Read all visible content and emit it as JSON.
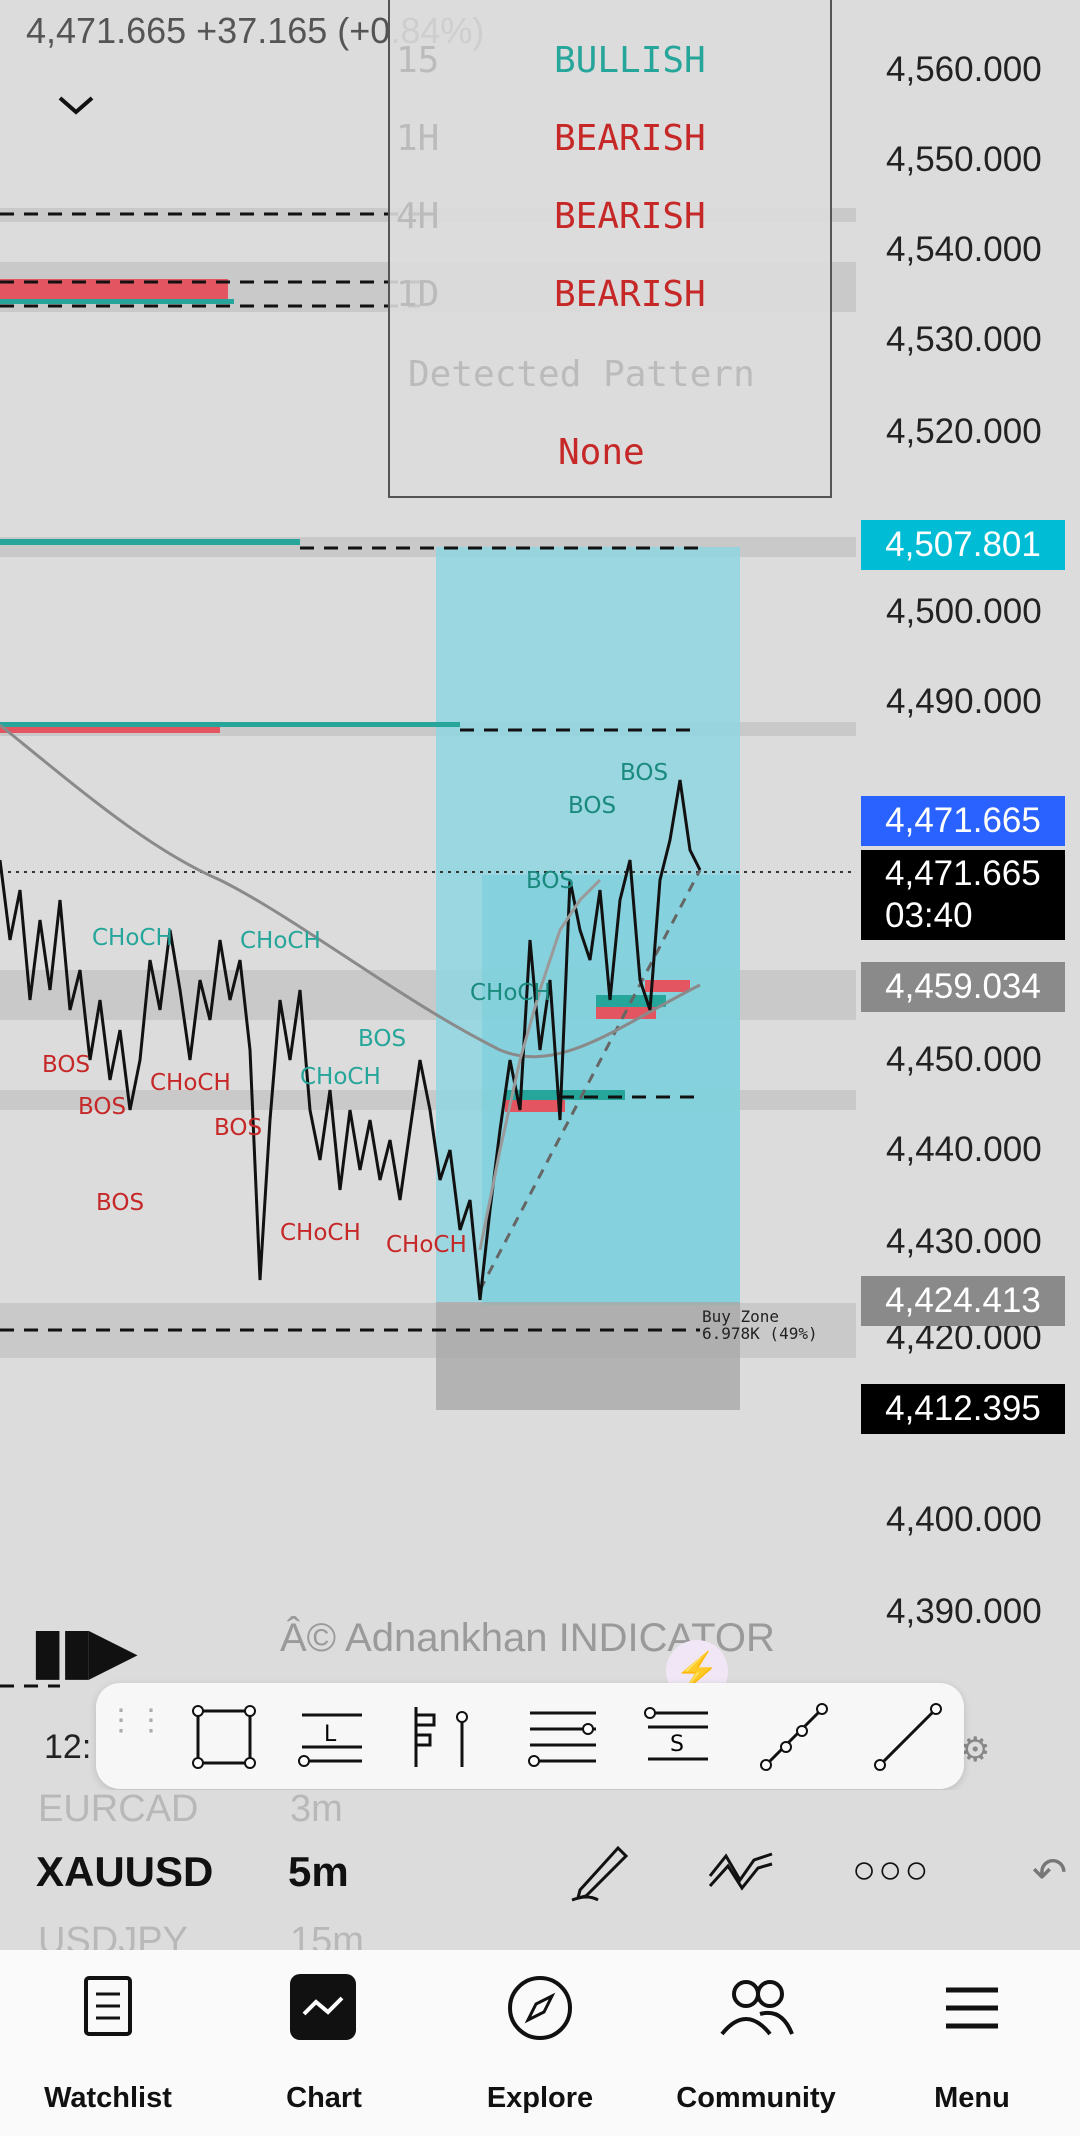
{
  "header": {
    "price_change": "4,471.665  +37.165 (+0.84%)",
    "chevron": "chevron-down-icon"
  },
  "signal_panel": {
    "rows": [
      {
        "tf": "15",
        "trend": "BULLISH",
        "color": "#26a69a"
      },
      {
        "tf": "1H",
        "trend": "BEARISH",
        "color": "#c62828"
      },
      {
        "tf": "4H",
        "trend": "BEARISH",
        "color": "#c62828"
      },
      {
        "tf": "1D",
        "trend": "BEARISH",
        "color": "#c62828"
      }
    ],
    "pattern_label": "Detected Pattern",
    "pattern_value": "None"
  },
  "price_axis": [
    "4,560.000",
    "4,550.000",
    "4,540.000",
    "4,530.000",
    "4,520.000",
    "4,500.000",
    "4,490.000",
    "4,450.000",
    "4,440.000",
    "4,430.000",
    "4,420.000",
    "4,400.000",
    "4,390.000"
  ],
  "price_tags": {
    "target": "4,507.801",
    "bid": "4,471.665",
    "last": "4,471.665",
    "countdown": "03:40",
    "entry": "4,459.034",
    "stop": "4,424.413",
    "low": "4,412.395"
  },
  "chart_labels": {
    "bos": "BOS",
    "choch": "CHoCH",
    "buy_zone": "Buy Zone",
    "buy_zone_detail": "6.978K (49%)"
  },
  "watermark": "Â© Adnankhan INDICATOR",
  "time_fragment": "12:",
  "tools": [
    "rectangle-tool",
    "long-position-tool",
    "fib-tool",
    "parallel-lines-tool",
    "short-position-tool",
    "path-tool",
    "trend-line-tool"
  ],
  "tool_labels": {
    "long": "L",
    "short": "S"
  },
  "symbols": {
    "prev": {
      "symbol": "EURCAD",
      "interval": "3m"
    },
    "current": {
      "symbol": "XAUUSD",
      "interval": "5m"
    },
    "next": {
      "symbol": "USDJPY",
      "interval": "15m"
    }
  },
  "nav": [
    {
      "label": "Watchlist",
      "icon": "watchlist-icon"
    },
    {
      "label": "Chart",
      "icon": "chart-icon"
    },
    {
      "label": "Explore",
      "icon": "compass-icon"
    },
    {
      "label": "Community",
      "icon": "community-icon"
    },
    {
      "label": "Menu",
      "icon": "menu-icon"
    }
  ],
  "colors": {
    "bull": "#26a69a",
    "bear": "#e35561",
    "target_zone": "#7fd3de",
    "accent_blue": "#2962ff",
    "cyan_tag": "#00bcd4"
  }
}
